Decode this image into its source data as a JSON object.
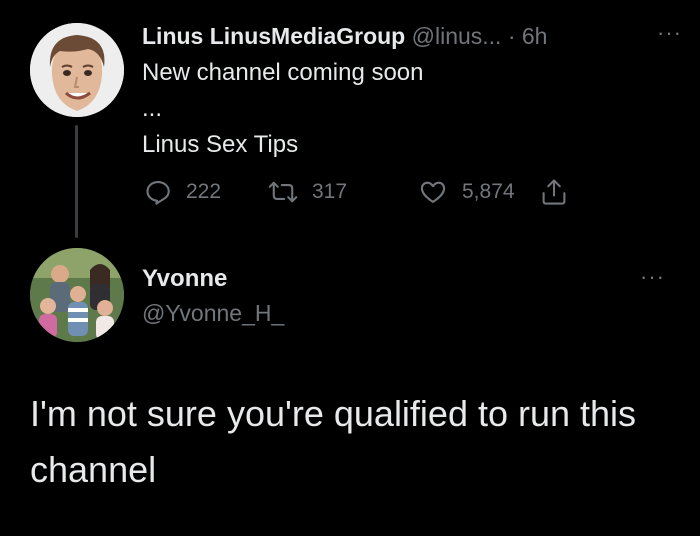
{
  "tweet": {
    "author_name": "Linus LinusMediaGroup",
    "author_handle": "@linus...",
    "time": "· 6h",
    "more_label": "···",
    "text_lines": [
      "New channel coming soon",
      "...",
      "Linus Sex Tips"
    ],
    "actions": {
      "replies": "222",
      "retweets": "317",
      "likes": "5,874"
    },
    "icons": [
      "reply-icon",
      "retweet-icon",
      "like-icon",
      "share-icon"
    ]
  },
  "reply": {
    "author_name": "Yvonne",
    "author_handle": "@Yvonne_H_",
    "more_label": "···",
    "text": "I'm not sure you're qualified to run this channel"
  },
  "colors": {
    "background": "#000000",
    "text": "#e7e9ea",
    "secondary": "#71767b",
    "thread_line": "#3a3d40"
  }
}
